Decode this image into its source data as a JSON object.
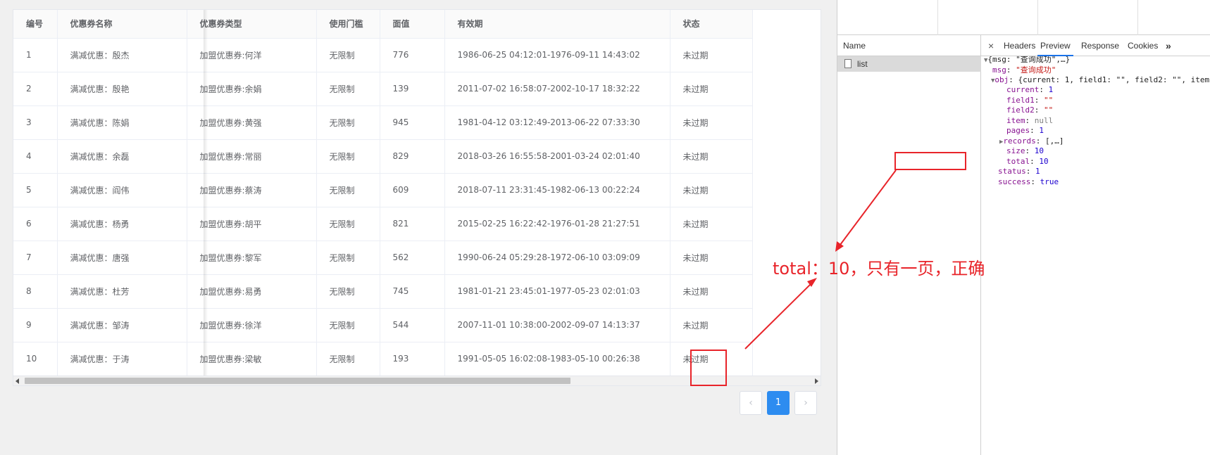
{
  "table": {
    "columns": [
      "编号",
      "优惠券名称",
      "优惠券类型",
      "使用门槛",
      "面值",
      "有效期",
      "状态"
    ],
    "rows": [
      [
        "1",
        "满减优惠：殷杰",
        "加盟优惠券:何洋",
        "无限制",
        "776",
        "1986-06-25 04:12:01-1976-09-11 14:43:02",
        "未过期"
      ],
      [
        "2",
        "满减优惠：殷艳",
        "加盟优惠券:余娟",
        "无限制",
        "139",
        "2011-07-02 16:58:07-2002-10-17 18:32:22",
        "未过期"
      ],
      [
        "3",
        "满减优惠：陈娟",
        "加盟优惠券:黄强",
        "无限制",
        "945",
        "1981-04-12 03:12:49-2013-06-22 07:33:30",
        "未过期"
      ],
      [
        "4",
        "满减优惠：余磊",
        "加盟优惠券:常丽",
        "无限制",
        "829",
        "2018-03-26 16:55:58-2001-03-24 02:01:40",
        "未过期"
      ],
      [
        "5",
        "满减优惠：阎伟",
        "加盟优惠券:蔡涛",
        "无限制",
        "609",
        "2018-07-11 23:31:45-1982-06-13 00:22:24",
        "未过期"
      ],
      [
        "6",
        "满减优惠：杨勇",
        "加盟优惠券:胡平",
        "无限制",
        "821",
        "2015-02-25 16:22:42-1976-01-28 21:27:51",
        "未过期"
      ],
      [
        "7",
        "满减优惠：唐强",
        "加盟优惠券:黎军",
        "无限制",
        "562",
        "1990-06-24 05:29:28-1972-06-10 03:09:09",
        "未过期"
      ],
      [
        "8",
        "满减优惠：杜芳",
        "加盟优惠券:易勇",
        "无限制",
        "745",
        "1981-01-21 23:45:01-1977-05-23 02:01:03",
        "未过期"
      ],
      [
        "9",
        "满减优惠：邹涛",
        "加盟优惠券:徐洋",
        "无限制",
        "544",
        "2007-11-01 10:38:00-2002-09-07 14:13:37",
        "未过期"
      ],
      [
        "10",
        "满减优惠：于涛",
        "加盟优惠券:梁敏",
        "无限制",
        "193",
        "1991-05-05 16:02:08-1983-05-10 00:26:38",
        "未过期"
      ]
    ]
  },
  "pagination": {
    "prev_icon": "chevron-left-icon",
    "prev_label": "‹",
    "current_page": "1",
    "next_icon": "chevron-right-icon",
    "next_label": "›"
  },
  "devtools": {
    "name_header": "Name",
    "request_name": "list",
    "tabs": {
      "close": "×",
      "headers": "Headers",
      "preview": "Preview",
      "response": "Response",
      "cookies": "Cookies",
      "more": "»"
    },
    "json": {
      "root_summary": "{msg: \"查询成功\",…}",
      "msg_key": "msg",
      "msg_value": "\"查询成功\"",
      "obj_key": "obj",
      "obj_summary": "{current: 1, field1: \"\", field2: \"\", item",
      "current_key": "current",
      "current_value": "1",
      "field1_key": "field1",
      "field1_value": "\"\"",
      "field2_key": "field2",
      "field2_value": "\"\"",
      "item_key": "item",
      "item_value": "null",
      "pages_key": "pages",
      "pages_value": "1",
      "records_key": "records",
      "records_value": "[,…]",
      "size_key": "size",
      "size_value": "10",
      "total_key": "total",
      "total_value": "10",
      "status_key": "status",
      "status_value": "1",
      "success_key": "success",
      "success_value": "true"
    }
  },
  "annotation": {
    "text": "total：10，只有一页，正确",
    "color": "#e8242a"
  },
  "colors": {
    "accent": "#2d8cf0",
    "json_key": "#881391",
    "json_string": "#c41a16",
    "json_number": "#1c00cf"
  }
}
